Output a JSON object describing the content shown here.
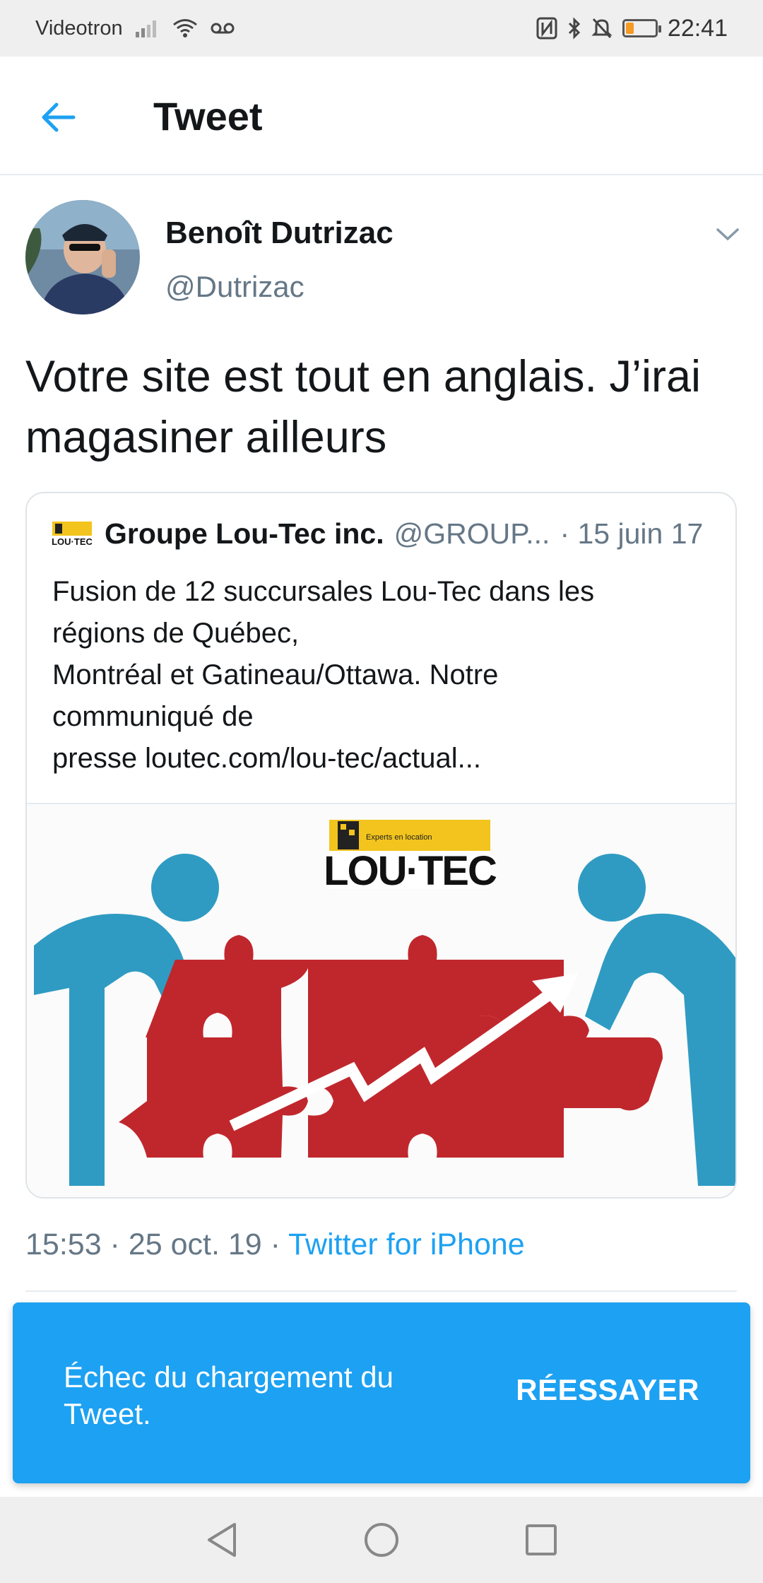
{
  "status_bar": {
    "carrier": "Videotron",
    "time": "22:41",
    "battery_level": 0.25,
    "icons": [
      "signal-icon",
      "wifi-icon",
      "voicemail-icon",
      "nfc-icon",
      "bluetooth-icon",
      "mute-icon",
      "battery-icon"
    ]
  },
  "header": {
    "title": "Tweet",
    "back_icon": "arrow-left-icon"
  },
  "tweet": {
    "author_name": "Benoît Dutrizac",
    "author_handle": "@Dutrizac",
    "text": "Votre site est tout en anglais. J’irai magasiner ailleurs",
    "timestamp": "15:53 · 25 oct. 19 · ",
    "source": "Twitter for iPhone"
  },
  "quoted_tweet": {
    "author_name": "Groupe Lou-Tec inc.",
    "author_handle": "@GROUP...",
    "date": "· 15 juin 17",
    "lines": [
      "Fusion de 12 succursales Lou-Tec dans les",
      "régions de Québec,",
      "Montréal et Gatineau/Ottawa. Notre",
      "communiqué de",
      "presse loutec.com/lou-tec/actual..."
    ],
    "image_logo_text": "LOU·TEC",
    "image_logo_tagline": "Experts en location"
  },
  "snackbar": {
    "message": "Échec du chargement du Tweet.",
    "action": "RÉESSAYER"
  },
  "colors": {
    "accent": "#1da1f2",
    "secondary_text": "#657786",
    "snackbar_bg": "#1da1f2",
    "puzzle_red": "#c0272d",
    "figure_blue": "#2f9bc2",
    "logo_yellow": "#f2c41d"
  }
}
